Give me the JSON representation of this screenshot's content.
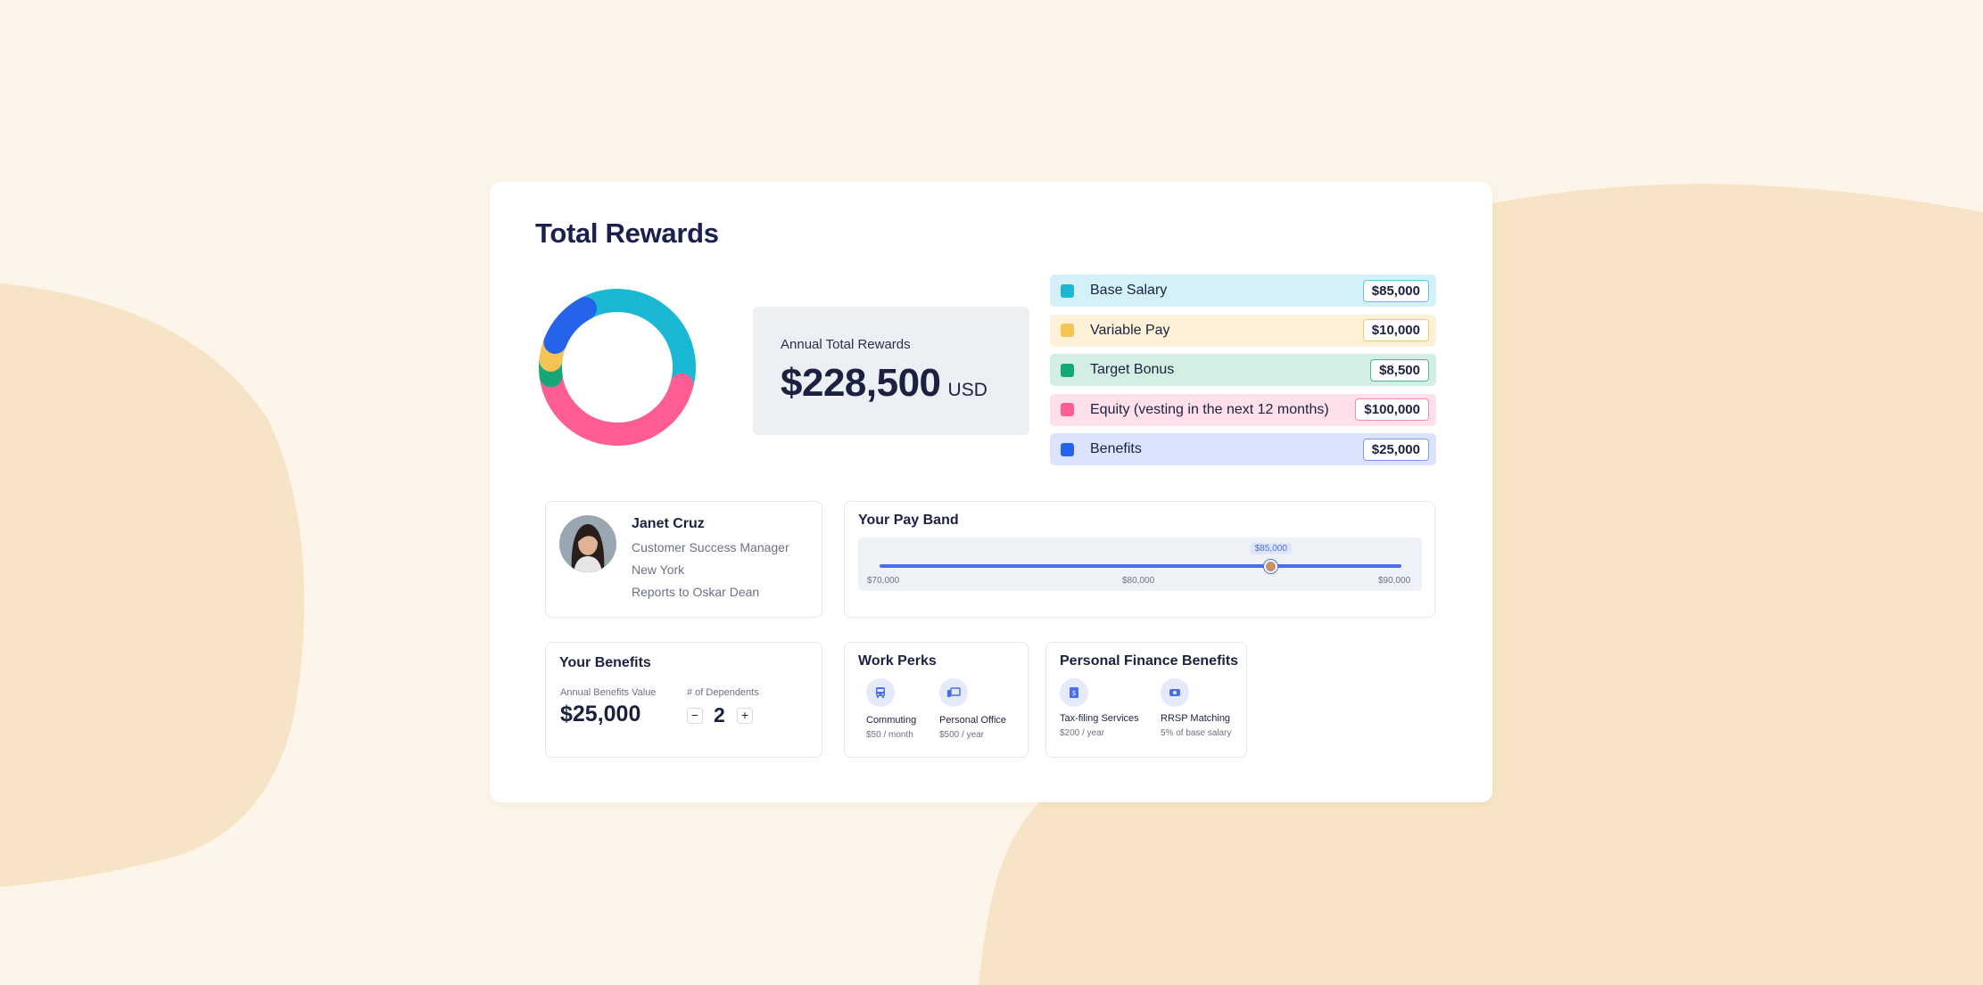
{
  "colors": {
    "base_salary": "#1bb8d6",
    "variable_pay": "#f6c455",
    "target_bonus": "#13a77a",
    "equity": "#fe5c95",
    "benefits": "#2563eb"
  },
  "page": {
    "title": "Total Rewards"
  },
  "total": {
    "label": "Annual Total Rewards",
    "amount": "$228,500",
    "currency": "USD"
  },
  "legend": [
    {
      "label": "Base Salary",
      "value": "$85,000",
      "color": "#1bb8d6",
      "bg": "#d3f1f7",
      "border": "#5fc8dc"
    },
    {
      "label": "Variable Pay",
      "value": "$10,000",
      "color": "#f6c455",
      "bg": "#fdf1d8",
      "border": "#f4c96a"
    },
    {
      "label": "Target Bonus",
      "value": "$8,500",
      "color": "#13a77a",
      "bg": "#d3efe3",
      "border": "#4fba90"
    },
    {
      "label": "Equity (vesting in the next 12 months)",
      "value": "$100,000",
      "color": "#fe5c95",
      "bg": "#fde0ea",
      "border": "#f789ad"
    },
    {
      "label": "Benefits",
      "value": "$25,000",
      "color": "#2563eb",
      "bg": "#dbe4fc",
      "border": "#7d9af0"
    }
  ],
  "chart_data": {
    "type": "pie",
    "categories": [
      "Base Salary",
      "Variable Pay",
      "Target Bonus",
      "Equity (vesting in the next 12 months)",
      "Benefits"
    ],
    "values": [
      85000,
      10000,
      8500,
      100000,
      25000
    ],
    "title": ""
  },
  "profile": {
    "name": "Janet Cruz",
    "role": "Customer Success Manager",
    "location": "New York",
    "reports_to": "Reports to Oskar Dean"
  },
  "payband": {
    "title": "Your Pay Band",
    "current": "$85,000",
    "min": "$70,000",
    "mid": "$80,000",
    "max": "$90,000",
    "position_fraction": 0.75
  },
  "benefits": {
    "title": "Your Benefits",
    "annual_label": "Annual Benefits Value",
    "annual_value": "$25,000",
    "dependents_label": "# of Dependents",
    "dependents_value": "2",
    "minus": "−",
    "plus": "+"
  },
  "perks": {
    "title": "Work Perks",
    "items": [
      {
        "name": "Commuting",
        "sub": "$50 / month",
        "icon": "bus-icon"
      },
      {
        "name": "Personal Office",
        "sub": "$500 / year",
        "icon": "devices-icon"
      }
    ]
  },
  "finance": {
    "title": "Personal Finance Benefits",
    "items": [
      {
        "name": "Tax-filing Services",
        "sub": "$200 / year",
        "icon": "receipt-icon"
      },
      {
        "name": "RRSP Matching",
        "sub": "5% of base salary",
        "icon": "piggy-bank-icon"
      }
    ]
  }
}
